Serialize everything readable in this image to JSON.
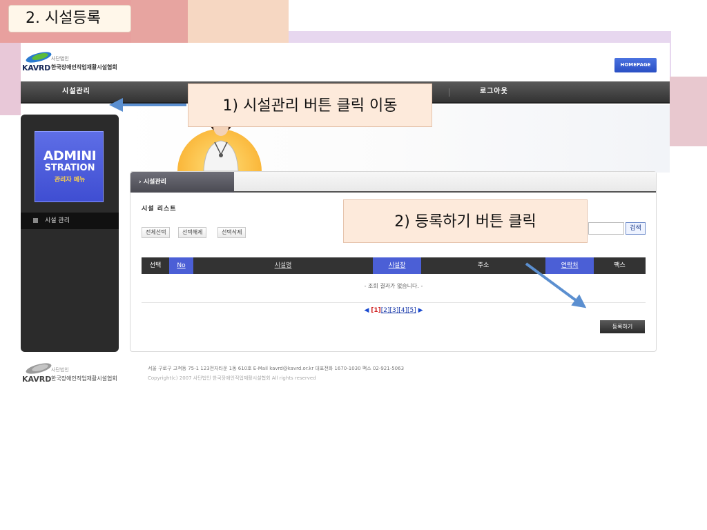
{
  "slide": {
    "title": "2. 시설등록"
  },
  "header": {
    "logo_small": "사단법인",
    "logo_org": "한국장애인직업재활시설협회",
    "logo_kavrd": "KAVRD",
    "homepage_label": "HOMEPAGE"
  },
  "topnav": {
    "items": [
      {
        "label": "시설관리"
      },
      {
        "label": "로그아웃"
      }
    ]
  },
  "sidebar": {
    "card_title_1": "ADMINI",
    "card_title_2": "STRATION",
    "card_sub": "관리자 메뉴",
    "menu_item": "시설 관리"
  },
  "content": {
    "tab_label": "› 시설관리",
    "section_title": "시설 리스트",
    "buttons": {
      "select_all": "전체선택",
      "deselect": "선택해제",
      "delete_selected": "선택삭제"
    },
    "search_label": "검색",
    "columns": [
      "선택",
      "No",
      "시설명",
      "시설장",
      "주소",
      "연락처",
      "팩스"
    ],
    "no_result": "- 조회 결과가 없습니다. -",
    "pager": {
      "prev": "◀",
      "current": "[1]",
      "pages": [
        "[2]",
        "[3]",
        "[4]",
        "[5]"
      ],
      "next": "▶"
    },
    "register_label": "등록하기"
  },
  "footer": {
    "logo_small": "사단법인",
    "logo_org": "한국장애인직업재활시설협회",
    "logo_kavrd": "KAVRD",
    "address": "서울 구로구 고척동 75-1 123전자타운 1동 610호 E-Mail kavrd@kavrd.or.kr  대표전화 1670-1030  팩스 02-921-5063",
    "copyright": "Copyright(c) 2007 사단법인 한국장애인직업재활시설협회 All rights reserved"
  },
  "annotations": {
    "callout1": "1) 시설관리 버튼 클릭 이동",
    "callout2": "2) 등록하기 버튼 클릭"
  },
  "colors": {
    "accent_blue": "#4b5fd6",
    "callout_bg": "#fdeadb",
    "arrow": "#5b8fd0"
  }
}
